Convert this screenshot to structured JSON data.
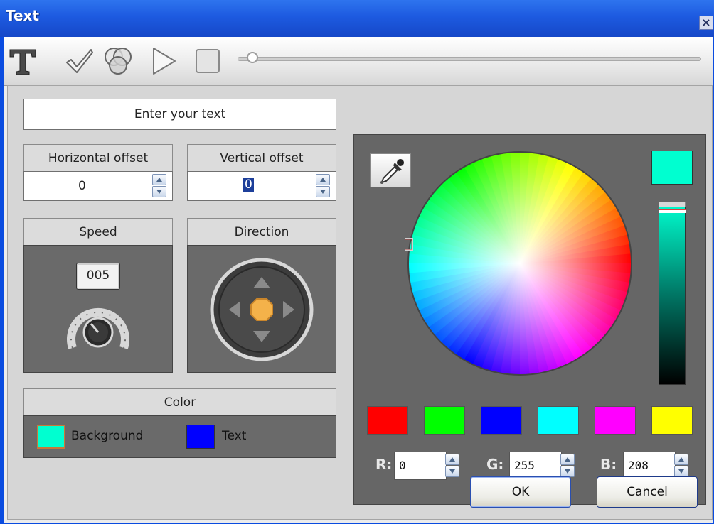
{
  "window": {
    "title": "Text",
    "close_glyph": "×"
  },
  "toolbar": {
    "icons": [
      "text-tool-icon",
      "checkmark-icon",
      "color-blend-icon",
      "play-icon",
      "stop-icon"
    ],
    "slider_position": 0.02
  },
  "text_input": {
    "placeholder": "Enter your text",
    "value": ""
  },
  "horizontal_offset": {
    "label": "Horizontal offset",
    "value": "0"
  },
  "vertical_offset": {
    "label": "Vertical offset",
    "value": "0"
  },
  "speed": {
    "label": "Speed",
    "value": "005"
  },
  "direction": {
    "label": "Direction"
  },
  "color_section": {
    "label": "Color",
    "background_label": "Background",
    "text_label": "Text",
    "background_color": "#00ffd0",
    "text_color": "#0000ff"
  },
  "color_picker": {
    "current_color": "#00ffd0",
    "swatches": [
      "#ff0000",
      "#00ff00",
      "#0000ff",
      "#00ffff",
      "#ff00ff",
      "#ffff00"
    ],
    "r": {
      "label": "R:",
      "value": "0"
    },
    "g": {
      "label": "G:",
      "value": "255"
    },
    "b": {
      "label": "B:",
      "value": "208"
    }
  },
  "buttons": {
    "ok": "OK",
    "cancel": "Cancel"
  }
}
